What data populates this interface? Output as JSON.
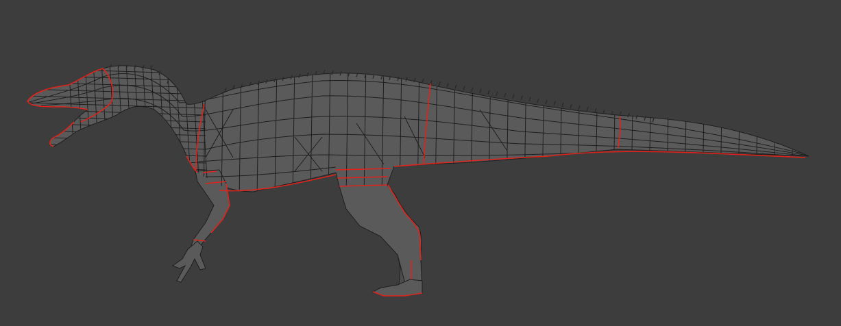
{
  "viewport": {
    "background": "#3d3d3d"
  },
  "model": {
    "subject": "spinosaur-wireframe-mesh",
    "mesh_fill": "#5a5a5a",
    "mesh_fill_dark": "#4d4d4d",
    "wire_color": "#1e1e1e",
    "seam_color": "#e0231a",
    "spike_color": "#2a2a2a"
  }
}
